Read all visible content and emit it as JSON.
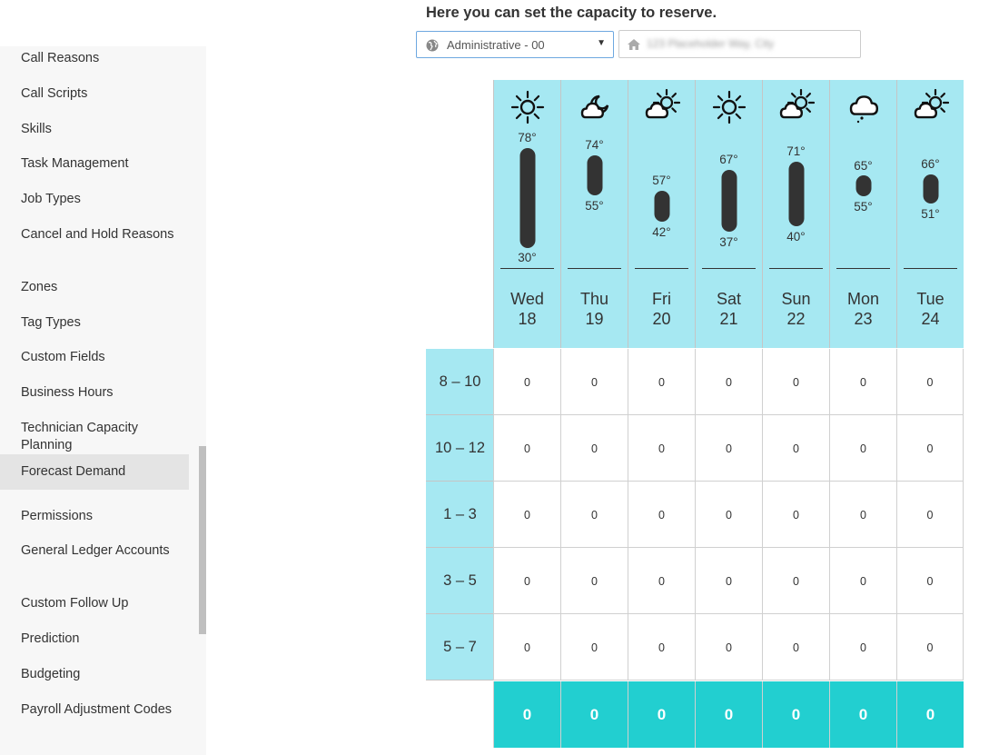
{
  "sidebar": {
    "items": [
      {
        "label": "Call Reasons"
      },
      {
        "label": "Call Scripts"
      },
      {
        "label": "Skills"
      },
      {
        "label": "Task Management"
      },
      {
        "label": "Job Types"
      },
      {
        "label": "Cancel and Hold Reasons"
      },
      {
        "label": "Zones"
      },
      {
        "label": "Tag Types"
      },
      {
        "label": "Custom Fields"
      },
      {
        "label": "Business Hours"
      },
      {
        "label": "Technician Capacity Planning"
      },
      {
        "label": "Forecast Demand",
        "active": true
      },
      {
        "label": "Permissions"
      },
      {
        "label": "General Ledger Accounts"
      },
      {
        "label": "Custom Follow Up"
      },
      {
        "label": "Prediction"
      },
      {
        "label": "Budgeting"
      },
      {
        "label": "Payroll Adjustment Codes"
      }
    ]
  },
  "header": {
    "title": "Here you can set the capacity to reserve.",
    "business_unit": {
      "value": "Administrative - 00",
      "icon": "globe-icon"
    },
    "address": {
      "value": "123 Placeholder Way, City",
      "icon": "home-icon"
    }
  },
  "forecast": {
    "days": [
      {
        "name": "Wed",
        "date": "18",
        "high": "78°",
        "low": "30°",
        "icon": "sun"
      },
      {
        "name": "Thu",
        "date": "19",
        "high": "74°",
        "low": "55°",
        "icon": "cloud-moon"
      },
      {
        "name": "Fri",
        "date": "20",
        "high": "57°",
        "low": "42°",
        "icon": "partly-cloudy"
      },
      {
        "name": "Sat",
        "date": "21",
        "high": "67°",
        "low": "37°",
        "icon": "sun"
      },
      {
        "name": "Sun",
        "date": "22",
        "high": "71°",
        "low": "40°",
        "icon": "partly-cloudy"
      },
      {
        "name": "Mon",
        "date": "23",
        "high": "65°",
        "low": "55°",
        "icon": "cloud"
      },
      {
        "name": "Tue",
        "date": "24",
        "high": "66°",
        "low": "51°",
        "icon": "partly-cloudy"
      }
    ],
    "time_slots": [
      "8 – 10",
      "10 – 12",
      "1 – 3",
      "3 – 5",
      "5 – 7"
    ],
    "capacity": [
      [
        "0",
        "0",
        "0",
        "0",
        "0",
        "0",
        "0"
      ],
      [
        "0",
        "0",
        "0",
        "0",
        "0",
        "0",
        "0"
      ],
      [
        "0",
        "0",
        "0",
        "0",
        "0",
        "0",
        "0"
      ],
      [
        "0",
        "0",
        "0",
        "0",
        "0",
        "0",
        "0"
      ],
      [
        "0",
        "0",
        "0",
        "0",
        "0",
        "0",
        "0"
      ]
    ],
    "totals": [
      "0",
      "0",
      "0",
      "0",
      "0",
      "0",
      "0"
    ]
  },
  "colors": {
    "header_bg": "#a6e8f2",
    "total_bg": "#22cfd0",
    "accent_border": "#6ea8e0"
  }
}
